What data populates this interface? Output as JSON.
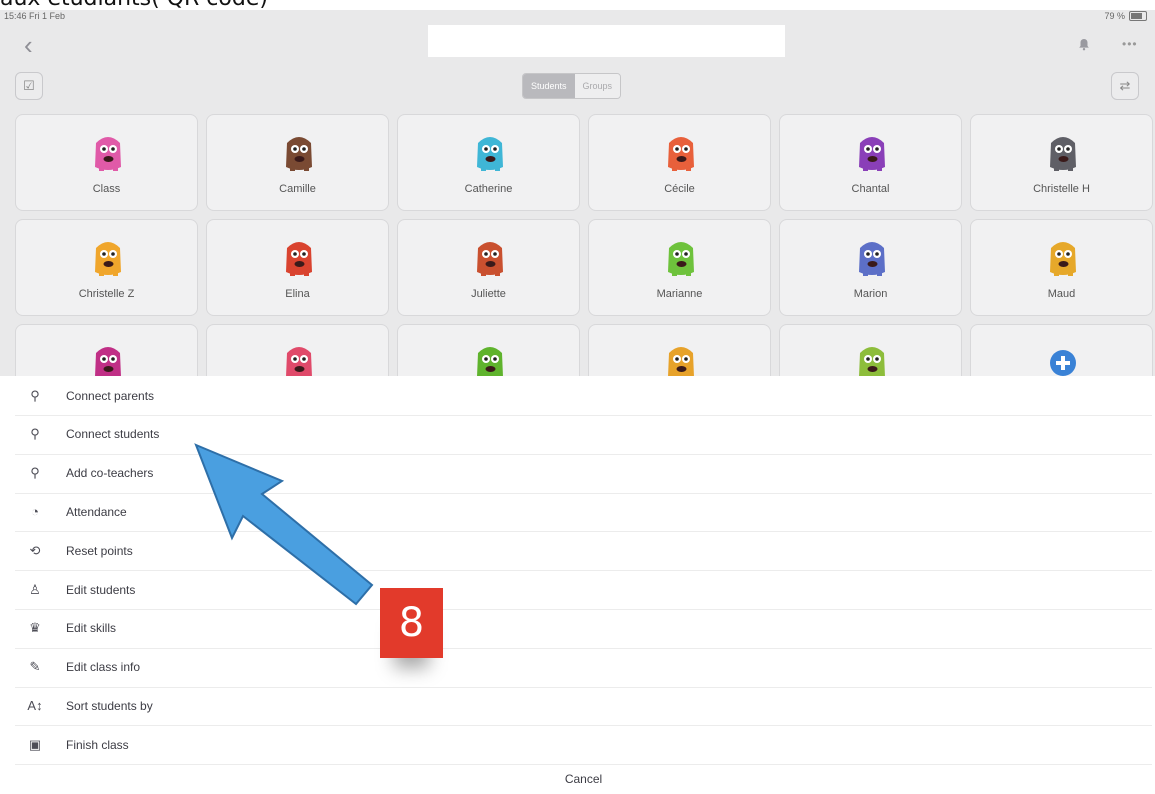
{
  "caption": "aux étudiants( QR code)",
  "status_bar": {
    "time": "15:46  Fri 1 Feb",
    "battery": "79 %",
    "battery_level": 0.79
  },
  "toolbar": {
    "back_icon": "chevron-left-icon",
    "bell_icon": "bell-icon",
    "more_icon": "more-icon"
  },
  "segment": {
    "students": "Students",
    "groups": "Groups",
    "selected": "Students"
  },
  "students": [
    {
      "name": "Class",
      "color": "#e05aa8"
    },
    {
      "name": "Camille",
      "color": "#7a4a33"
    },
    {
      "name": "Catherine",
      "color": "#3fb6d6"
    },
    {
      "name": "Cécile",
      "color": "#e8603b"
    },
    {
      "name": "Chantal",
      "color": "#8a3fb8"
    },
    {
      "name": "Christelle H",
      "color": "#5f5f66"
    },
    {
      "name": "Christelle Z",
      "color": "#f0a62c"
    },
    {
      "name": "Elina",
      "color": "#d9432f"
    },
    {
      "name": "Juliette",
      "color": "#c9502f"
    },
    {
      "name": "Marianne",
      "color": "#6ec23c"
    },
    {
      "name": "Marion",
      "color": "#5c6fc7"
    },
    {
      "name": "Maud",
      "color": "#e6a82a"
    },
    {
      "name": "",
      "color": "#c02f86"
    },
    {
      "name": "",
      "color": "#e04a6a"
    },
    {
      "name": "",
      "color": "#5fb32d"
    },
    {
      "name": "",
      "color": "#e7a22a"
    },
    {
      "name": "",
      "color": "#8dbd3b"
    },
    {
      "name": "",
      "color": "#3a82d6"
    }
  ],
  "menu": [
    {
      "label": "Connect parents",
      "icon": "person-link-icon",
      "glyph": "⚲"
    },
    {
      "label": "Connect students",
      "icon": "person-link-icon",
      "glyph": "⚲"
    },
    {
      "label": "Add co-teachers",
      "icon": "person-link-icon",
      "glyph": "⚲"
    },
    {
      "label": "Attendance",
      "icon": "clock-icon",
      "glyph": "◔"
    },
    {
      "label": "Reset points",
      "icon": "reset-icon",
      "glyph": "⟲"
    },
    {
      "label": "Edit students",
      "icon": "edit-students-icon",
      "glyph": "♙"
    },
    {
      "label": "Edit skills",
      "icon": "trophy-icon",
      "glyph": "♛"
    },
    {
      "label": "Edit class info",
      "icon": "pencil-icon",
      "glyph": "✎"
    },
    {
      "label": "Sort students by",
      "icon": "sort-icon",
      "glyph": "A↕"
    },
    {
      "label": "Finish class",
      "icon": "finish-icon",
      "glyph": "▣"
    }
  ],
  "cancel_label": "Cancel",
  "annotation": {
    "step": "8",
    "arrow_color": "#4a9fe0",
    "badge_color": "#e23a2b"
  }
}
